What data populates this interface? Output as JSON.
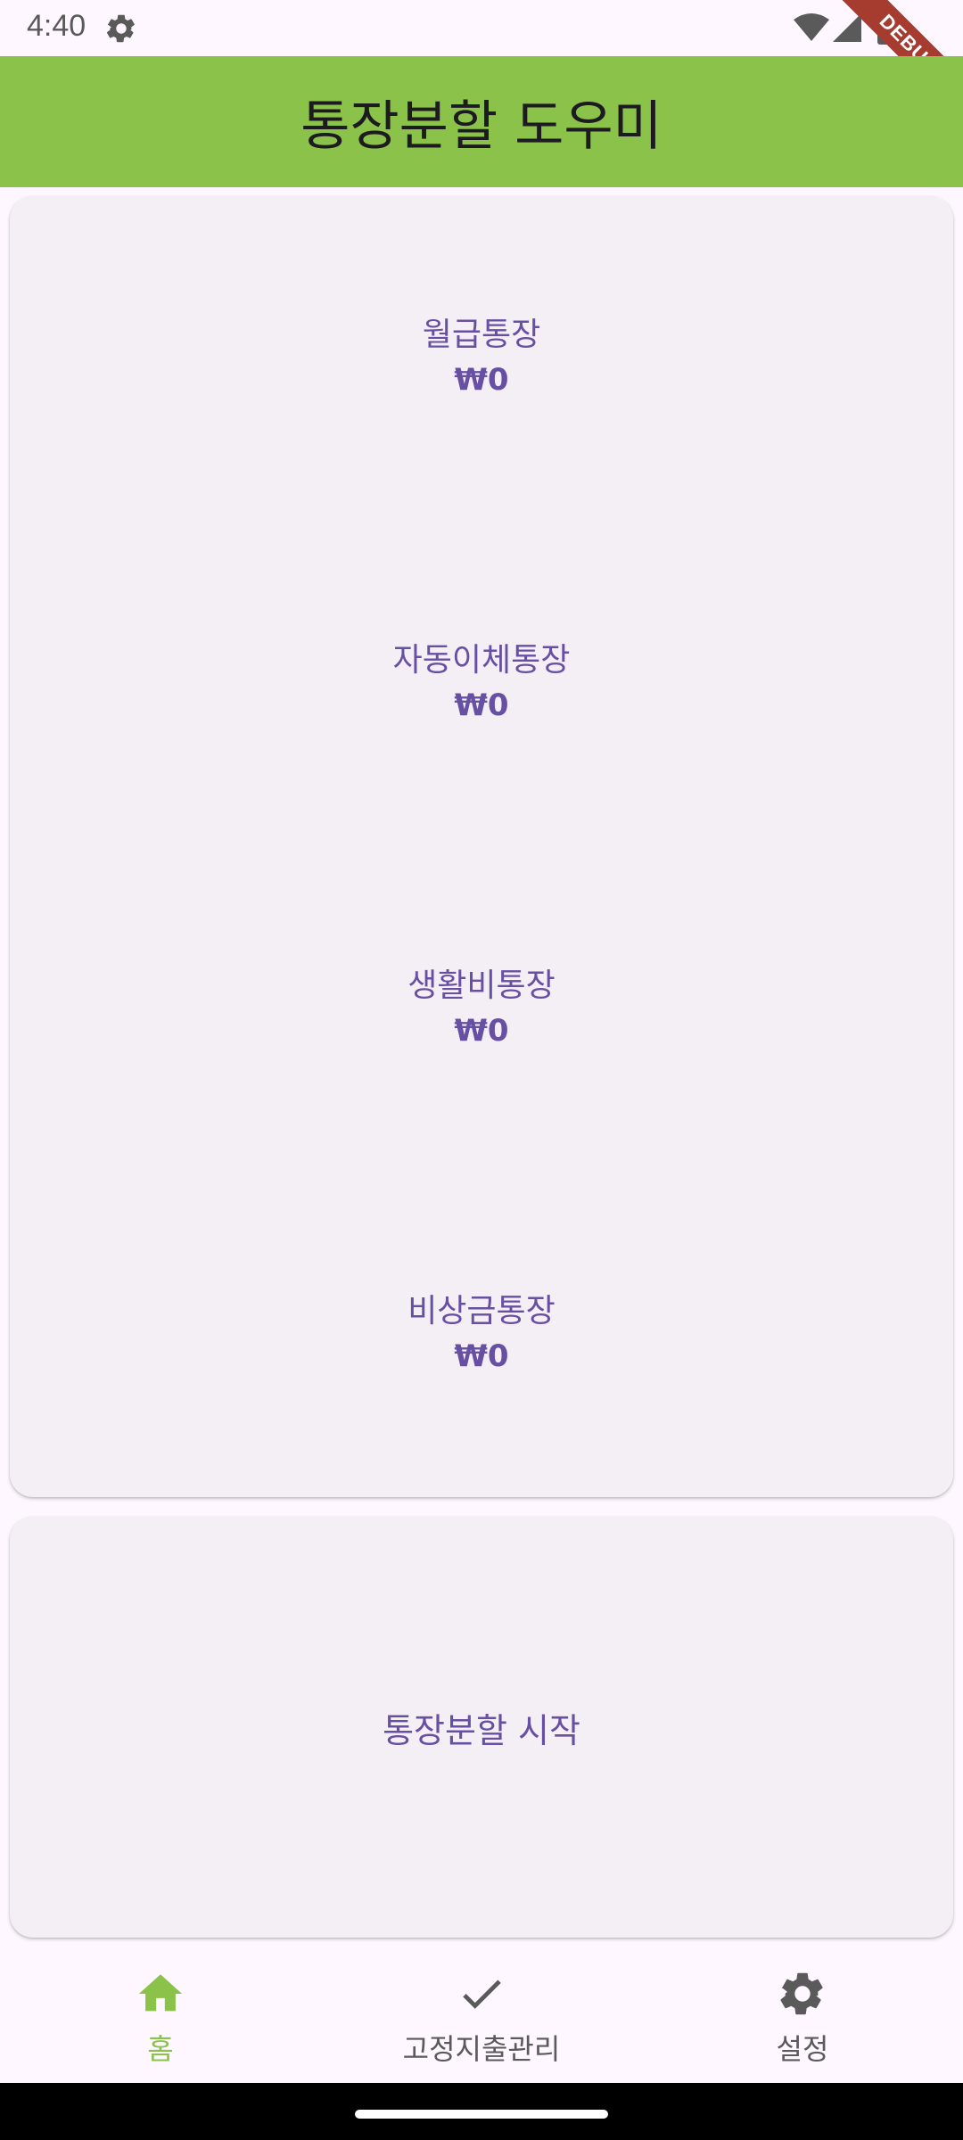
{
  "status_bar": {
    "time": "4:40"
  },
  "debug_banner": {
    "label": "DEBUG"
  },
  "app_bar": {
    "title": "통장분할 도우미",
    "color": "#8BC34A"
  },
  "accounts": [
    {
      "name": "월급통장",
      "balance": "₩0"
    },
    {
      "name": "자동이체통장",
      "balance": "₩0"
    },
    {
      "name": "생활비통장",
      "balance": "₩0"
    },
    {
      "name": "비상금통장",
      "balance": "₩0"
    }
  ],
  "start_card": {
    "label": "통장분할 시작"
  },
  "bottom_nav": {
    "items": [
      {
        "label": "홈",
        "icon": "home-icon",
        "active": true
      },
      {
        "label": "고정지출관리",
        "icon": "check-icon",
        "active": false
      },
      {
        "label": "설정",
        "icon": "gear-icon",
        "active": false
      }
    ],
    "active_color": "#8BC34A"
  },
  "theme": {
    "primary_text": "#6750A4",
    "card_background": "#F4EFF5"
  }
}
